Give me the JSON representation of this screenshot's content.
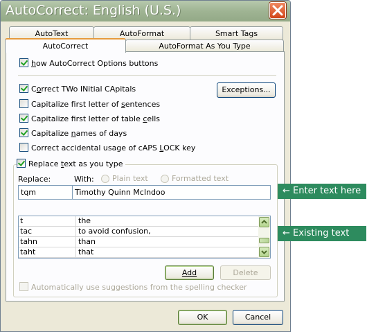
{
  "window": {
    "title": "AutoCorrect: English (U.S.)"
  },
  "tabs": {
    "row_back": [
      "AutoText",
      "AutoFormat",
      "Smart Tags"
    ],
    "row_front": [
      "AutoCorrect",
      "AutoFormat As You Type"
    ],
    "active": "AutoCorrect"
  },
  "options": {
    "show_buttons": {
      "pre": "",
      "key": "h",
      "post": "ow AutoCorrect Options buttons",
      "full": "Show AutoCorrect Options buttons",
      "checked": true
    },
    "correct_two_initial": {
      "pre": "C",
      "key": "o",
      "post": "rrect TWo INitial CApitals",
      "full": "Correct TWo INitial CApitals",
      "checked": true
    },
    "capitalize_first_sentences": {
      "pre": "Capitalize first letter of ",
      "key": "s",
      "post": "entences",
      "full": "Capitalize first letter of sentences",
      "checked": false
    },
    "capitalize_first_table": {
      "pre": "Capitalize first letter of table ",
      "key": "c",
      "post": "ells",
      "full": "Capitalize first letter of table cells",
      "checked": true
    },
    "capitalize_days": {
      "pre": "Capitalize ",
      "key": "n",
      "post": "ames of days",
      "full": "Capitalize names of days",
      "checked": true
    },
    "caps_lock": {
      "pre": "Correct accidental usage of cAPS ",
      "key": "L",
      "post": "OCK key",
      "full": "Correct accidental usage of cAPS LOCK key",
      "checked": false
    },
    "replace_as_you_type": {
      "pre": "Replace ",
      "key": "t",
      "post": "ext as you type",
      "full": "Replace text as you type",
      "checked": true
    },
    "auto_suggestions": {
      "pre": "Automatically use suggestions from the spelling checker",
      "key": "",
      "post": "",
      "full": "Automatically use suggestions from the spelling checker",
      "checked": false,
      "disabled": true
    }
  },
  "buttons": {
    "exceptions": "Exceptions...",
    "add": "Add",
    "delete": "Delete",
    "ok": "OK",
    "cancel": "Cancel"
  },
  "replace_section": {
    "replace_label": "Replace:",
    "with_label": "With:",
    "plain_text": "Plain text",
    "formatted_text": "Formatted text",
    "replace_value": "tqm",
    "with_value": "Timothy Quinn McIndoo"
  },
  "entries": [
    {
      "replace": "t",
      "with": "the"
    },
    {
      "replace": "tac",
      "with": "to avoid confusion,"
    },
    {
      "replace": "tahn",
      "with": "than"
    },
    {
      "replace": "taht",
      "with": "that"
    }
  ],
  "callouts": {
    "enter_text": "Enter text here",
    "existing_text": "Existing text"
  },
  "icons": {
    "close": "close-icon",
    "arrow": "arrow-left-icon",
    "scroll_up": "chevron-up-icon",
    "scroll_down": "chevron-down-icon"
  },
  "colors": {
    "titlebar": "#9fb493",
    "close_button": "#d2461a",
    "callout": "#2d8b5e",
    "active_tab_accent": "#e69a3c",
    "check": "#21a121"
  }
}
